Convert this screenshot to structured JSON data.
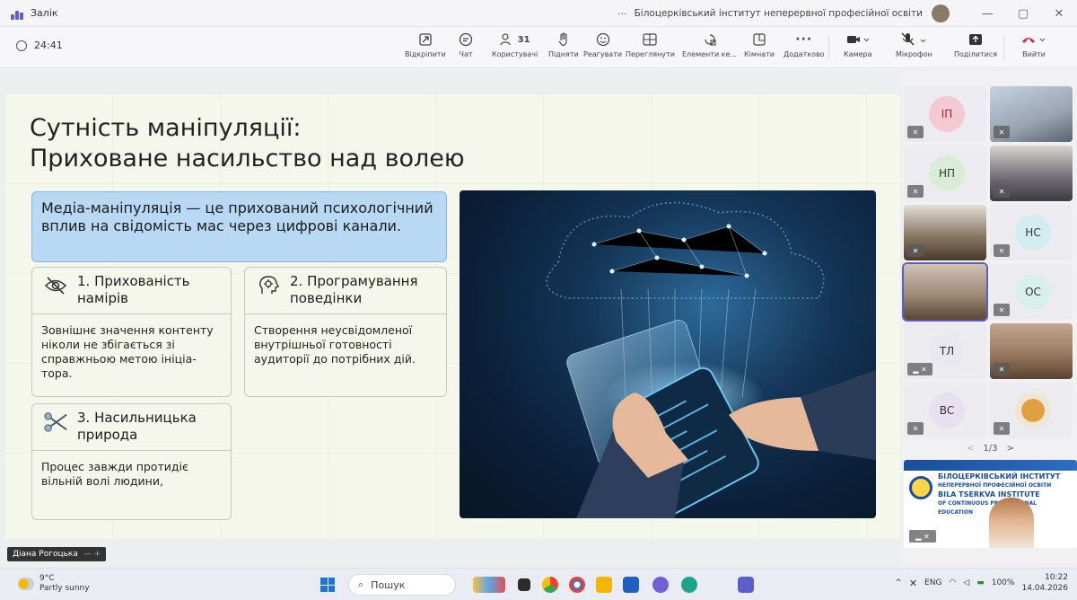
{
  "window": {
    "app_name": "Залік",
    "more": "···",
    "org": "Білоцерківський інститут неперервної професійної освіти",
    "minimize": "—",
    "restore": "▢",
    "close": "✕"
  },
  "toolbar": {
    "timer": "24:41",
    "items": [
      {
        "label": "Відкріпити",
        "icon": "unpin-icon"
      },
      {
        "label": "Чат",
        "icon": "chat-icon"
      },
      {
        "label": "Користувачі",
        "icon": "people-icon",
        "count": "31"
      },
      {
        "label": "Підняти",
        "icon": "raise-hand-icon"
      },
      {
        "label": "Реагувати",
        "icon": "react-icon"
      },
      {
        "label": "Переглянути",
        "icon": "view-icon"
      },
      {
        "label": "Елементи ке...",
        "icon": "apps-icon"
      },
      {
        "label": "Кімнати",
        "icon": "rooms-icon"
      },
      {
        "label": "Додатково",
        "icon": "more-icon"
      },
      {
        "label": "Камера",
        "icon": "camera-icon"
      },
      {
        "label": "Мікрофон",
        "icon": "mic-off-icon"
      },
      {
        "label": "Поділитися",
        "icon": "share-icon"
      },
      {
        "label": "Вийти",
        "icon": "leave-icon"
      }
    ]
  },
  "slide": {
    "title_line1": "Сутність маніпуляції:",
    "title_line2": "Приховане насильство над волею",
    "callout": "Медіа-маніпуляція — це прихований психологічний вплив на свідомість мас через цифрові канали.",
    "cards": [
      {
        "title": "1. Прихованість намірів",
        "icon": "eye-slash-icon",
        "body": "Зовнішнє значення контенту ніколи не збігається зі справжньою метою ініціа-тора."
      },
      {
        "title": "2. Програмування поведінки",
        "icon": "head-gear-icon",
        "body": "Створення неусвідомленої внутрішньої готовності аудиторії до потрібних дій."
      },
      {
        "title": "3. Насильницька природа",
        "icon": "scissors-icon",
        "body": "Процес завжди протидіє вільній волі людини,"
      }
    ]
  },
  "presenter_tag": {
    "name": "Діана Рогоцька",
    "extra": "—  +"
  },
  "participants": {
    "tiles": [
      {
        "initials": "ІП",
        "color": "#f4c9d0"
      },
      {
        "initials": "",
        "photo": true,
        "color": "#9aa4b2"
      },
      {
        "initials": "НП",
        "color": "#d8ecd8"
      },
      {
        "initials": "",
        "photo": true,
        "color": "#6d6a72"
      },
      {
        "initials": "",
        "photo": true,
        "color": "#8b7a66"
      },
      {
        "initials": "НС",
        "color": "#d3ecf0"
      },
      {
        "initials": "",
        "photo": true,
        "color": "#a08a78",
        "selected": true
      },
      {
        "initials": "ОС",
        "color": "#d9f0ea"
      },
      {
        "initials": "ТЛ",
        "color": "#e8e8ee"
      },
      {
        "initials": "",
        "photo": true,
        "color": "#9a7a60"
      },
      {
        "initials": "ВС",
        "color": "#e8e0f0"
      },
      {
        "initials": "",
        "photo": true,
        "color": "#f0e6d4"
      }
    ],
    "pager": {
      "prev": "<",
      "page": "1/3",
      "next": ">"
    },
    "banner": {
      "line1": "БІЛОЦЕРКІВСЬКИЙ ІНСТИТУТ",
      "line2": "НЕПЕРЕРВНОЇ ПРОФЕСІЙНОЇ ОСВІТИ",
      "line3": "BILA TSERKVA INSTITUTE",
      "line4": "OF CONTINUOUS PROFESSIONAL",
      "line5": "EDUCATION"
    }
  },
  "taskbar": {
    "weather_temp": "9°C",
    "weather_desc": "Partly sunny",
    "search": "Пошук",
    "lang": "ENG",
    "battery": "100%",
    "time": "10:22",
    "date": "14.04.2026"
  },
  "colors": {
    "accent": "#5b5fc7",
    "callout": "#b9d8f4",
    "leave": "#c4314b"
  }
}
